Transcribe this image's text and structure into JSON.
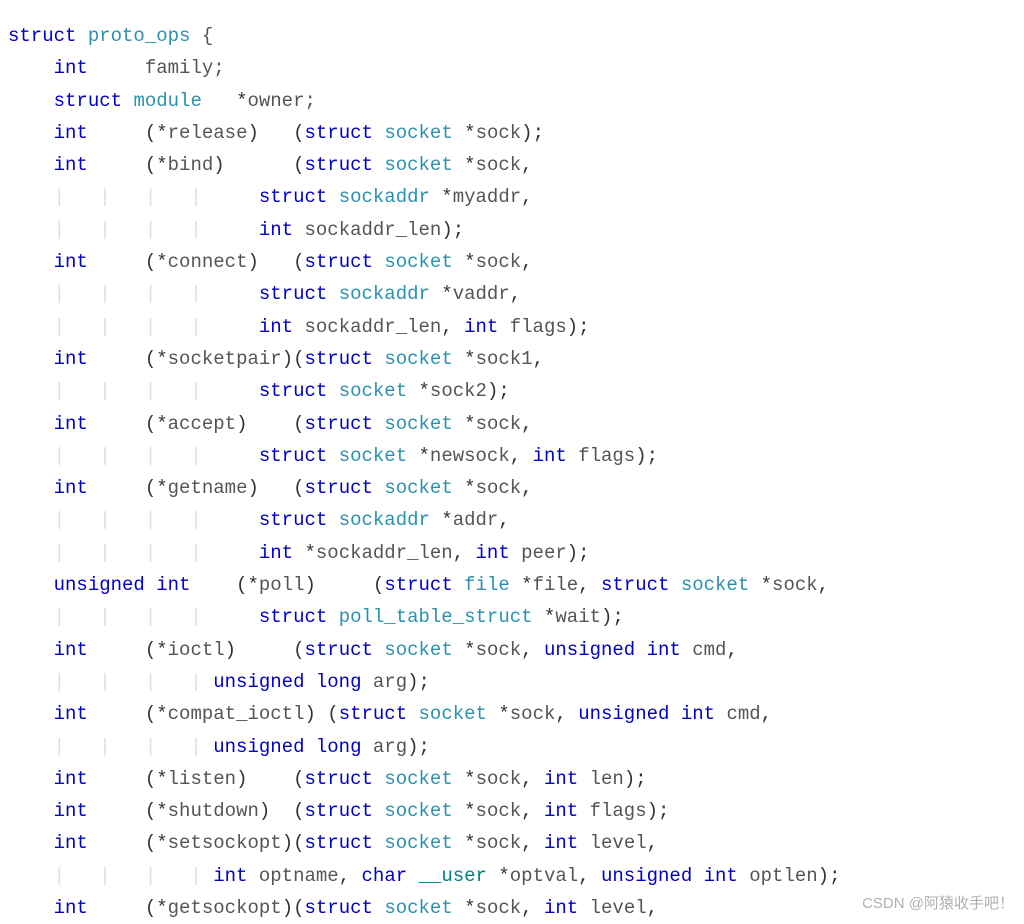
{
  "watermark": "CSDN @阿猿收手吧！",
  "tokens": {
    "struct": "struct",
    "int": "int",
    "unsigned": "unsigned",
    "long": "long",
    "char": "char",
    "proto_ops": "proto_ops",
    "module": "module",
    "socket": "socket",
    "sockaddr": "sockaddr",
    "file": "file",
    "poll_table_struct": "poll_table_struct",
    "__user": "__user",
    "family": "family",
    "owner": "owner",
    "release": "release",
    "bind": "bind",
    "connect": "connect",
    "socketpair": "socketpair",
    "accept": "accept",
    "getname": "getname",
    "poll": "poll",
    "ioctl": "ioctl",
    "compat_ioctl": "compat_ioctl",
    "listen": "listen",
    "shutdown": "shutdown",
    "setsockopt": "setsockopt",
    "getsockopt": "getsockopt",
    "sock": "sock",
    "sock1": "sock1",
    "sock2": "sock2",
    "newsock": "newsock",
    "myaddr": "myaddr",
    "vaddr": "vaddr",
    "addr": "addr",
    "wait": "wait",
    "sockaddr_len": "sockaddr_len",
    "flags": "flags",
    "peer": "peer",
    "cmd": "cmd",
    "arg": "arg",
    "len": "len",
    "level": "level",
    "optname": "optname",
    "optval": "optval",
    "optlen": "optlen"
  }
}
